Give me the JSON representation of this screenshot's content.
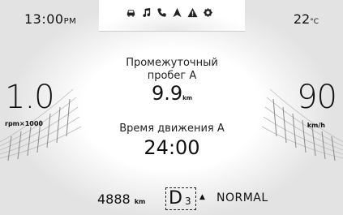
{
  "status": {
    "time": "13:00",
    "time_suffix": "PM",
    "temperature": "22",
    "temperature_unit": "°C"
  },
  "icons": [
    "car-icon",
    "music-note-icon",
    "phone-icon",
    "navigation-arrow-icon",
    "warning-triangle-icon",
    "settings-gear-icon"
  ],
  "left_gauge": {
    "value": "1.0",
    "unit": "rpm×1000"
  },
  "right_gauge": {
    "value": "90",
    "unit": "km/h"
  },
  "trip": {
    "label_line1": "Промежуточный",
    "label_line2": "пробег A",
    "value": "9.9",
    "unit": "km"
  },
  "drive_time": {
    "label": "Время движения A",
    "value": "24:00"
  },
  "bottom": {
    "odometer": "4888",
    "odometer_unit": "km",
    "gear": "D",
    "gear_number": "3",
    "gear_arrow": "▲",
    "mode": "NORMAL"
  }
}
